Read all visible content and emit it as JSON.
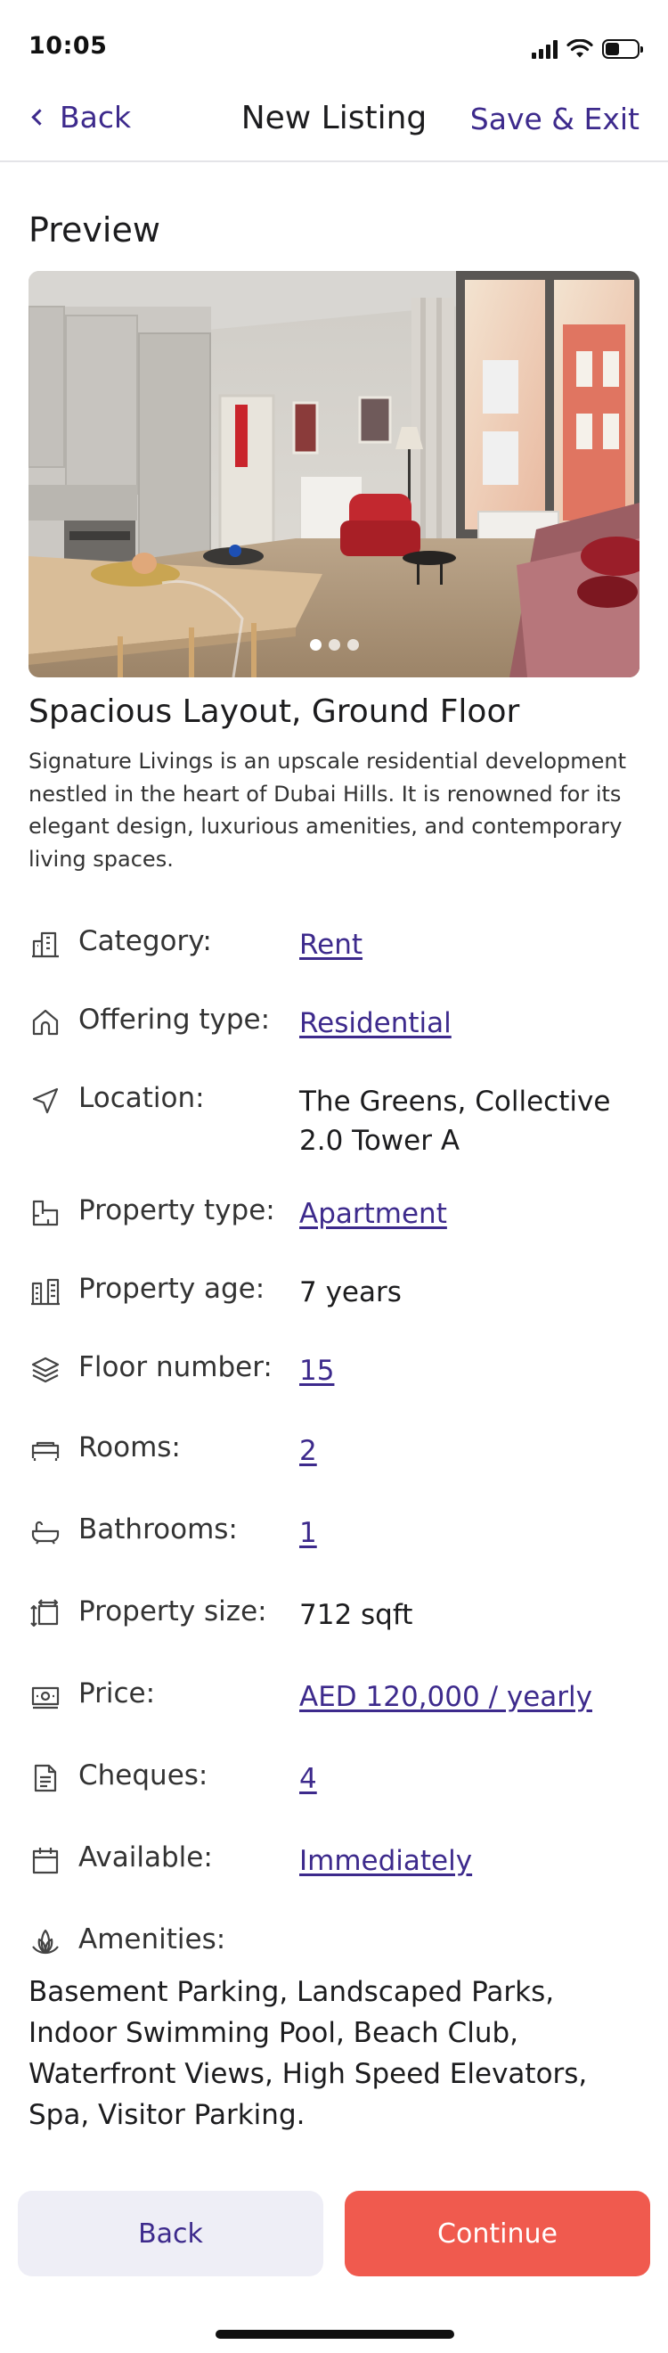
{
  "status_bar": {
    "time": "10:05"
  },
  "nav": {
    "back_label": "Back",
    "title": "New Listing",
    "save_label": "Save & Exit"
  },
  "preview": {
    "section_title": "Preview",
    "gallery": {
      "image_count": 3,
      "active_index": 0
    },
    "title": "Spacious Layout, Ground Floor",
    "description": "Signature Livings is an upscale residential development nestled in the heart of Dubai Hills. It is renowned for its elegant design, luxurious amenities, and contemporary living spaces."
  },
  "details": [
    {
      "id": "category",
      "icon": "building-icon",
      "label": "Category:",
      "value": "Rent",
      "link": true
    },
    {
      "id": "offering-type",
      "icon": "home-icon",
      "label": "Offering type:",
      "value": "Residential",
      "link": true
    },
    {
      "id": "location",
      "icon": "navigation-arrow-icon",
      "label": "Location:",
      "value": "The Greens, Collective 2.0 Tower A",
      "link": false
    },
    {
      "id": "property-type",
      "icon": "floorplan-icon",
      "label": "Property type:",
      "value": "Apartment",
      "link": true
    },
    {
      "id": "property-age",
      "icon": "buildings-icon",
      "label": "Property age:",
      "value": "7 years",
      "link": false
    },
    {
      "id": "floor-number",
      "icon": "layers-icon",
      "label": "Floor number:",
      "value": "15",
      "link": true
    },
    {
      "id": "rooms",
      "icon": "bed-icon",
      "label": "Rooms:",
      "value": "2",
      "link": true
    },
    {
      "id": "bathrooms",
      "icon": "bathtub-icon",
      "label": "Bathrooms:",
      "value": "1",
      "link": true
    },
    {
      "id": "property-size",
      "icon": "size-icon",
      "label": "Property size:",
      "value": "712 sqft",
      "link": false
    },
    {
      "id": "price",
      "icon": "banknote-icon",
      "label": "Price:",
      "value": "AED 120,000 / yearly",
      "link": true
    },
    {
      "id": "cheques",
      "icon": "document-icon",
      "label": "Cheques:",
      "value": "4",
      "link": true
    },
    {
      "id": "available",
      "icon": "calendar-icon",
      "label": "Available:",
      "value": "Immediately",
      "link": true
    }
  ],
  "amenities": {
    "icon": "leaf-icon",
    "label": "Amenities:",
    "text": "Basement Parking, Landscaped Parks, Indoor Swimming Pool, Beach Club, Waterfront Views, High Speed Elevators, Spa, Visitor Parking."
  },
  "footer": {
    "back_label": "Back",
    "continue_label": "Continue"
  },
  "colors": {
    "accent": "#3d2a8c",
    "primary_button": "#f05a4e",
    "secondary_button": "#eeeef6"
  }
}
